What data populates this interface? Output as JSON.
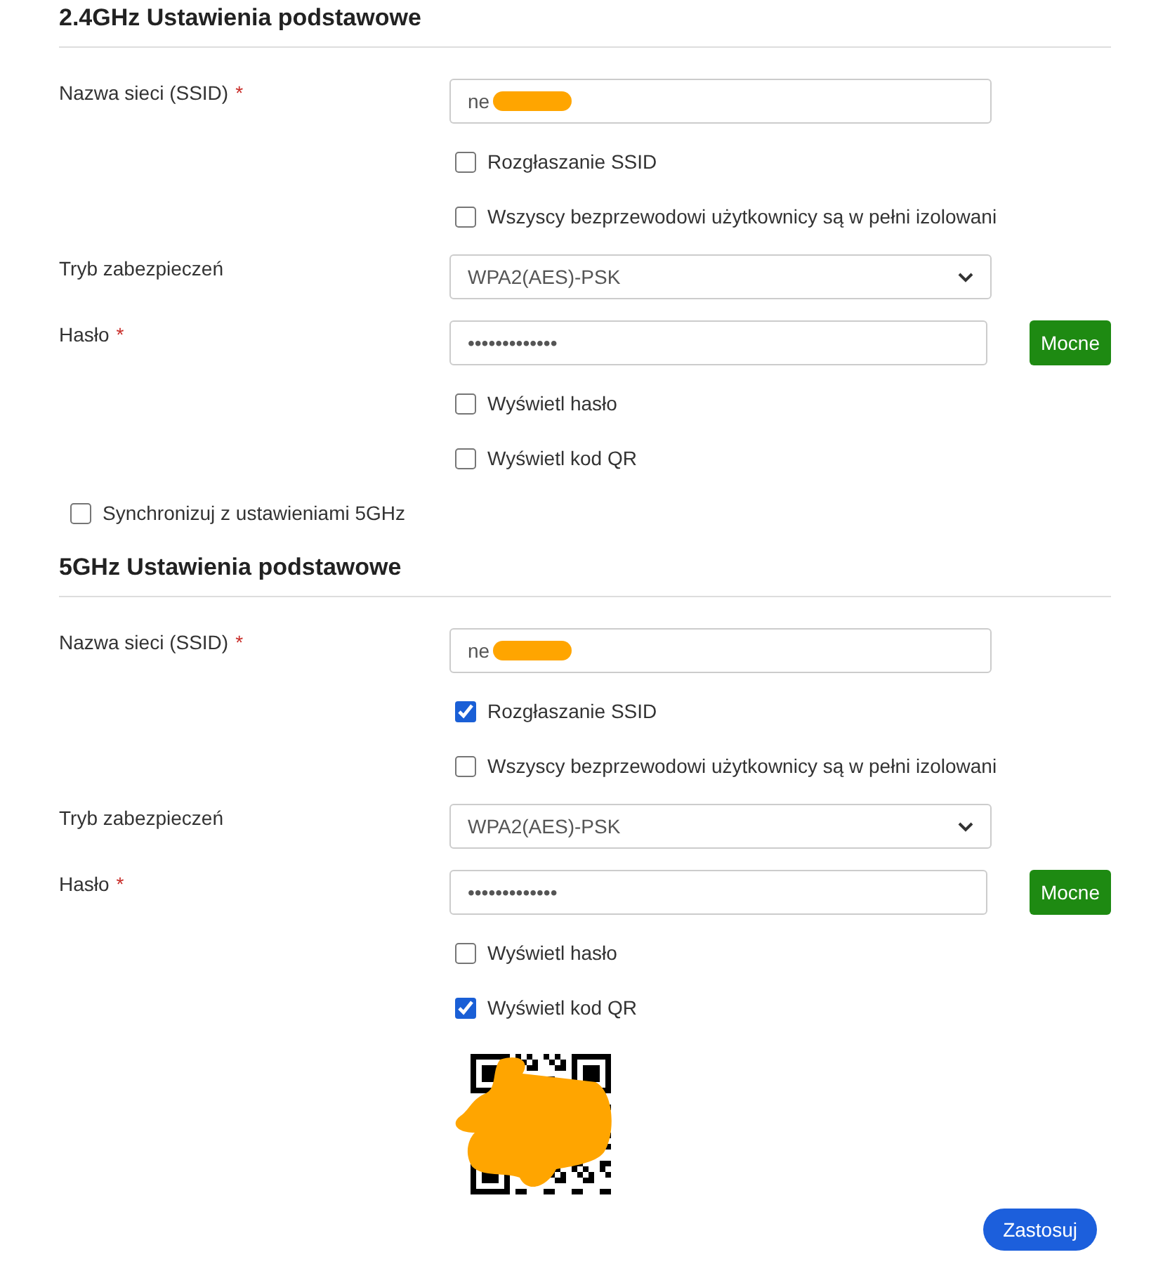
{
  "sections": [
    {
      "title": "2.4GHz Ustawienia podstawowe",
      "rows": [
        {
          "kind": "text",
          "label": "Nazwa sieci (SSID)",
          "marker": "*",
          "value": "ne",
          "redacted": true
        },
        {
          "kind": "checkbox",
          "label": "Rozgłaszanie SSID",
          "checked": false
        },
        {
          "kind": "checkbox",
          "label": "Wszyscy bezprzewodowi użytkownicy są w pełni izolowani",
          "checked": false
        },
        {
          "kind": "select",
          "label": "Tryb zabezpieczeń",
          "value": "WPA2(AES)-PSK"
        },
        {
          "kind": "password",
          "label": "Hasło",
          "marker": "*",
          "value": "•••••••••••••",
          "strength": "Mocne"
        },
        {
          "kind": "checkbox",
          "label": "Wyświetl hasło",
          "checked": false
        },
        {
          "kind": "checkbox",
          "label": "Wyświetl kod QR",
          "checked": false
        },
        {
          "kind": "wide-checkbox",
          "label": "Synchronizuj z ustawieniami 5GHz",
          "checked": false
        }
      ]
    },
    {
      "title": "5GHz Ustawienia podstawowe",
      "rows": [
        {
          "kind": "text",
          "label": "Nazwa sieci (SSID)",
          "marker": "*",
          "value": "ne",
          "redacted": true
        },
        {
          "kind": "checkbox",
          "label": "Rozgłaszanie SSID",
          "checked": true
        },
        {
          "kind": "checkbox",
          "label": "Wszyscy bezprzewodowi użytkownicy są w pełni izolowani",
          "checked": false
        },
        {
          "kind": "select",
          "label": "Tryb zabezpieczeń",
          "value": "WPA2(AES)-PSK"
        },
        {
          "kind": "password",
          "label": "Hasło",
          "marker": "*",
          "value": "•••••••••••••",
          "strength": "Mocne"
        },
        {
          "kind": "checkbox",
          "label": "Wyświetl hasło",
          "checked": false
        },
        {
          "kind": "checkbox",
          "label": "Wyświetl kod QR",
          "checked": true
        },
        {
          "kind": "qr",
          "redacted": true
        }
      ]
    }
  ],
  "apply_button": "Zastosuj"
}
